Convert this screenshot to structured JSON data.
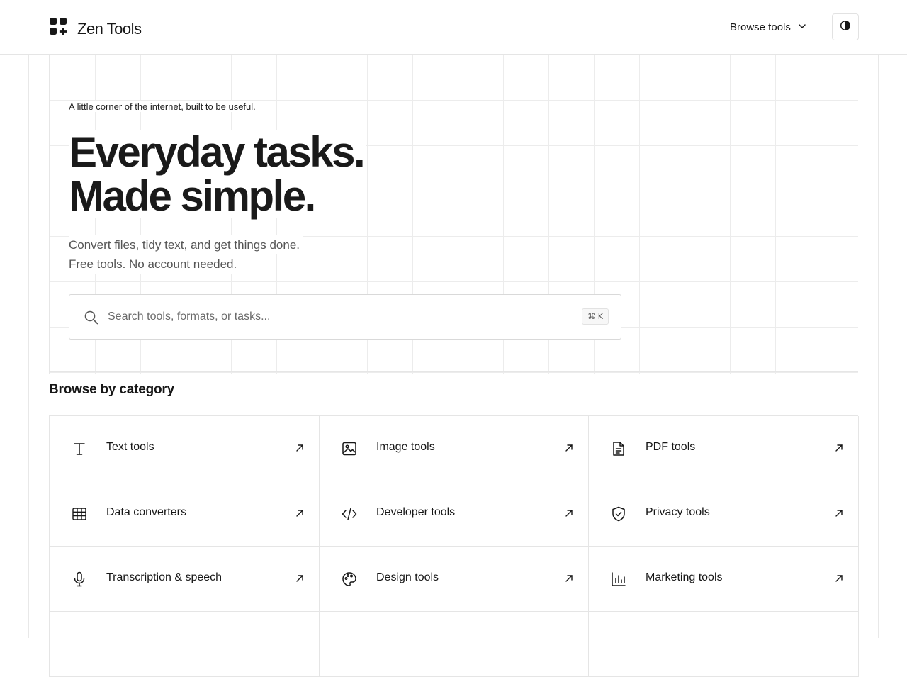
{
  "header": {
    "brand_name": "Zen Tools",
    "browse_label": "Browse tools",
    "theme_toggle_icon": "contrast-icon"
  },
  "hero": {
    "eyebrow": "A little corner of the internet, built to be useful.",
    "headline_line1": "Everyday tasks.",
    "headline_line2": "Made simple.",
    "sub_line1": "Convert files, tidy text, and get things done.",
    "sub_line2": "Free tools. No account needed.",
    "search_placeholder": "Search tools, formats, or tasks...",
    "search_value": "",
    "shortcut": "⌘ K"
  },
  "categories": {
    "title": "Browse by category",
    "items": [
      {
        "label": "Text tools",
        "icon": "text-icon"
      },
      {
        "label": "Image tools",
        "icon": "image-icon"
      },
      {
        "label": "PDF tools",
        "icon": "file-icon"
      },
      {
        "label": "Data converters",
        "icon": "table-icon"
      },
      {
        "label": "Developer tools",
        "icon": "code-icon"
      },
      {
        "label": "Privacy tools",
        "icon": "shield-check-icon"
      },
      {
        "label": "Transcription & speech",
        "icon": "microphone-icon"
      },
      {
        "label": "Design tools",
        "icon": "palette-icon"
      },
      {
        "label": "Marketing tools",
        "icon": "bar-chart-icon"
      }
    ]
  },
  "colors": {
    "text": "#171717",
    "muted": "#555555",
    "border": "#e5e5e5",
    "grid": "#ececec"
  }
}
